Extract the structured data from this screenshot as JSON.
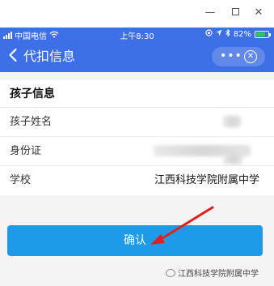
{
  "window": {
    "minimize_glyph": "—",
    "close_glyph": "✕"
  },
  "status_bar": {
    "carrier": "中国电信",
    "time": "上午8:30",
    "battery_percent": "82%",
    "battery_level": 0.82
  },
  "nav": {
    "back_glyph": "‹",
    "title": "代扣信息",
    "more_glyph": "•••",
    "close_glyph": "✕"
  },
  "form": {
    "section_title": "孩子信息",
    "rows": [
      {
        "label": "孩子姓名",
        "value": ""
      },
      {
        "label": "身份证",
        "value": ""
      },
      {
        "label": "学校",
        "value": "江西科技学院附属中学"
      }
    ]
  },
  "confirm_label": "确认",
  "watermark": "江西科技学院附属中学",
  "colors": {
    "nav_blue": "#3d6fe6",
    "button_blue": "#1e9be8",
    "arrow_red": "#e0201c"
  }
}
